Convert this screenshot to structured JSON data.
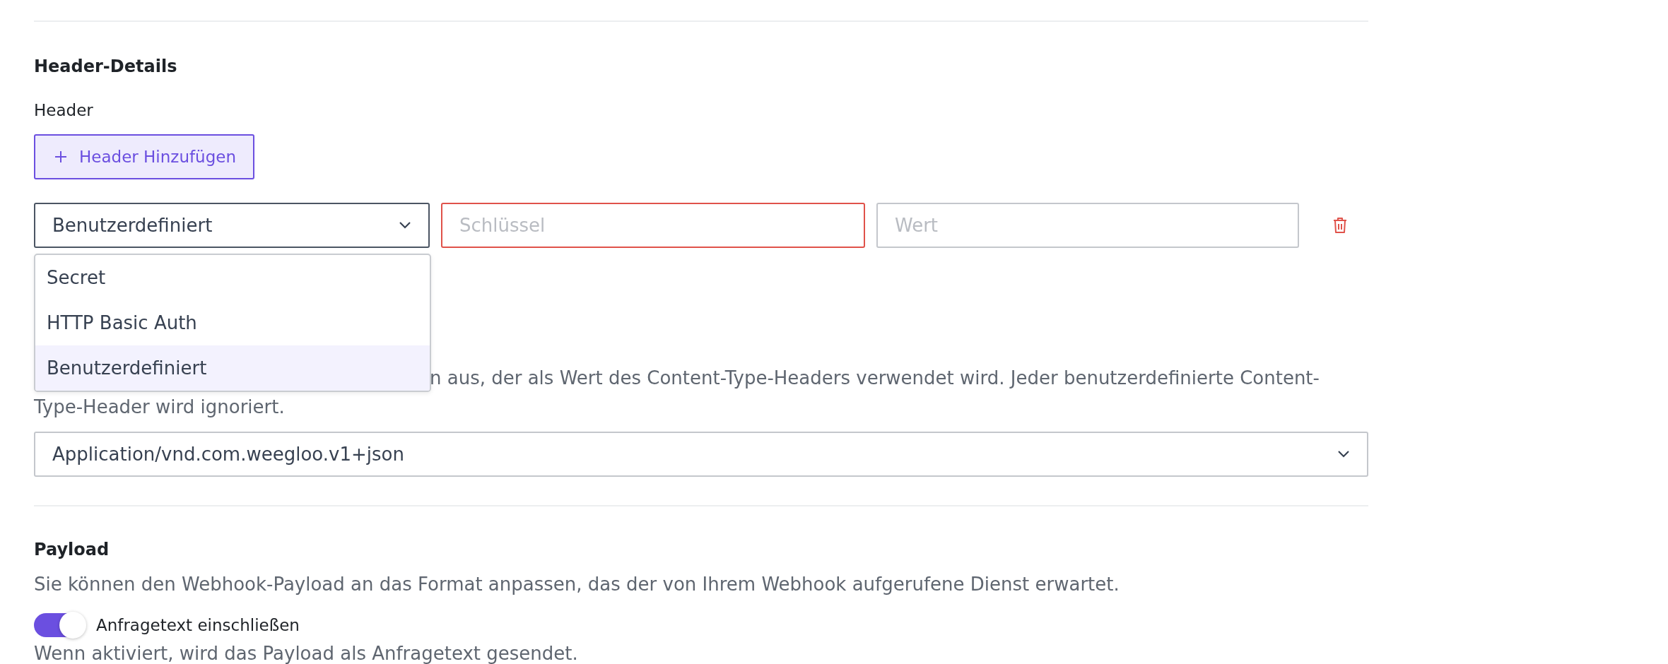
{
  "header_details": {
    "title": "Header-Details",
    "label": "Header",
    "add_button": "Header Hinzufügen",
    "header_row": {
      "type_select": {
        "value": "Benutzerdefiniert",
        "expanded": true,
        "options": [
          {
            "label": "Secret",
            "selected": false
          },
          {
            "label": "HTTP Basic Auth",
            "selected": false
          },
          {
            "label": "Benutzerdefiniert",
            "selected": true
          }
        ]
      },
      "key_field": {
        "placeholder": "Schlüssel",
        "invalid": true
      },
      "value_field": {
        "placeholder": "Wert",
        "invalid": false
      }
    }
  },
  "content_type": {
    "description_lines": [
      "n aus, der als Wert des Content-Type-Headers verwendet wird. Jeder benutzerdefinierte Content-",
      "Type-Header wird ignoriert."
    ],
    "select": {
      "value": "Application/vnd.com.weegloo.v1+json"
    }
  },
  "payload": {
    "title": "Payload",
    "description": "Sie können den Webhook-Payload an das Format anpassen, das der von Ihrem Webhook aufgerufene Dienst erwartet.",
    "toggle": {
      "label": "Anfragetext einschließen",
      "on": true
    },
    "hint": "Wenn aktiviert, wird das Payload als Anfragetext gesendet."
  }
}
